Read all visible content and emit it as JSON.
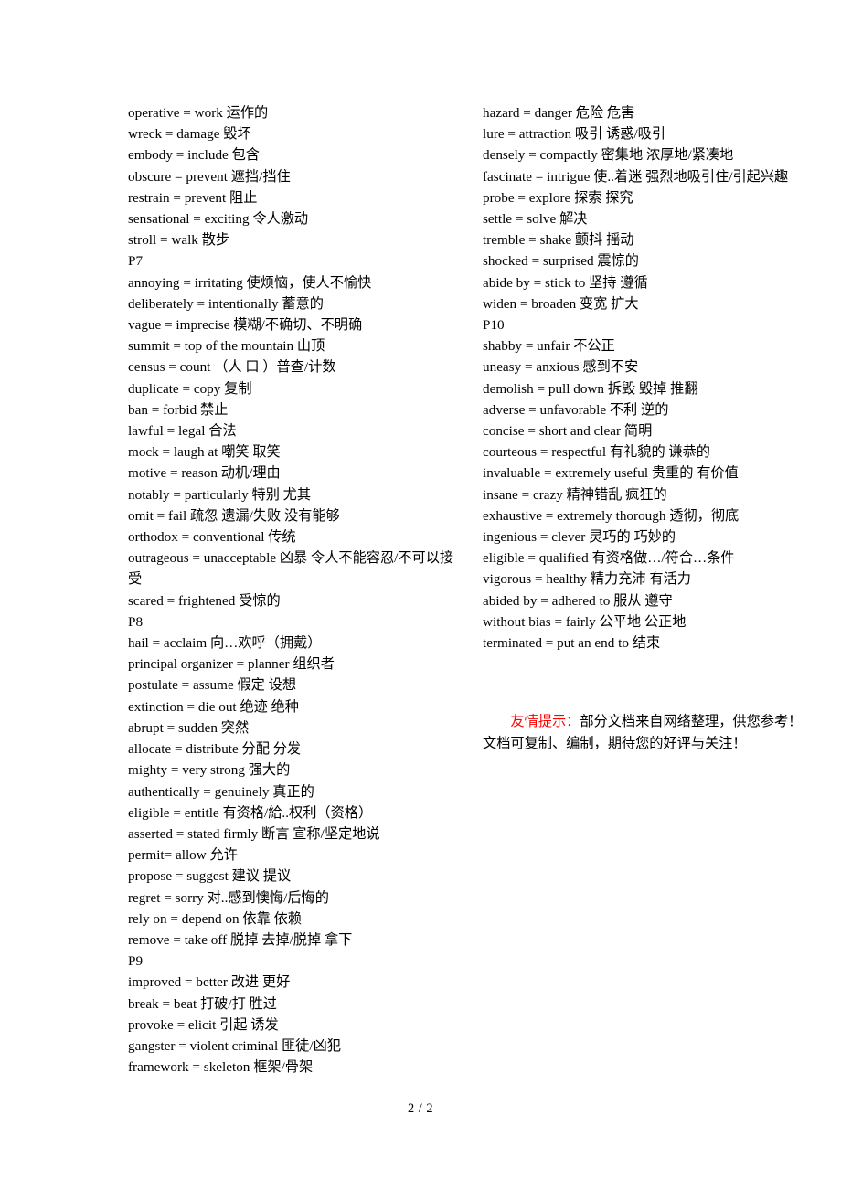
{
  "document": {
    "page_label": "2 / 2"
  },
  "left_column": [
    {
      "text": "operative = work 运作的",
      "type": "entry"
    },
    {
      "text": "wreck = damage 毁坏",
      "type": "entry"
    },
    {
      "text": "embody = include 包含",
      "type": "entry"
    },
    {
      "text": "obscure = prevent 遮挡/挡住",
      "type": "entry"
    },
    {
      "text": "restrain = prevent 阻止",
      "type": "entry"
    },
    {
      "text": "sensational = exciting 令人激动",
      "type": "entry"
    },
    {
      "text": "stroll = walk  散步",
      "type": "entry"
    },
    {
      "text": "P7",
      "type": "section"
    },
    {
      "text": "annoying = irritating 使烦恼，使人不愉快",
      "type": "entry"
    },
    {
      "text": "deliberately = intentionally  蓄意的",
      "type": "entry"
    },
    {
      "text": "vague = imprecise 模糊/不确切、不明确",
      "type": "entry"
    },
    {
      "text": "summit = top of the mountain  山顶",
      "type": "entry"
    },
    {
      "text": "census = count  （人 口 ）普查/计数",
      "type": "entry"
    },
    {
      "text": "duplicate  =  copy 复制",
      "type": "entry"
    },
    {
      "text": "ban = forbid  禁止",
      "type": "entry"
    },
    {
      "text": "lawful = legal  合法",
      "type": "entry"
    },
    {
      "text": "mock = laugh at  嘲笑  取笑",
      "type": "entry"
    },
    {
      "text": "motive = reason  动机/理由",
      "type": "entry"
    },
    {
      "text": "notably = particularly  特别  尤其",
      "type": "entry"
    },
    {
      "text": "omit = fail  疏忽  遗漏/失败  没有能够",
      "type": "entry"
    },
    {
      "text": "orthodox = conventional  传统",
      "type": "entry"
    },
    {
      "text": "outrageous = unacceptable  凶暴  令人不能容忍/不可以接受",
      "type": "entry"
    },
    {
      "text": "scared = frightened  受惊的",
      "type": "entry"
    },
    {
      "text": "P8",
      "type": "section"
    },
    {
      "text": "hail = acclaim  向…欢呼（拥戴）",
      "type": "entry"
    },
    {
      "text": "principal organizer = planner  组织者",
      "type": "entry"
    },
    {
      "text": "postulate = assume  假定  设想",
      "type": "entry"
    },
    {
      "text": "extinction = die out  绝迹  绝种",
      "type": "entry"
    },
    {
      "text": "abrupt = sudden  突然",
      "type": "entry"
    },
    {
      "text": "allocate = distribute  分配  分发",
      "type": "entry"
    },
    {
      "text": "mighty = very strong  强大的",
      "type": "entry"
    },
    {
      "text": "authentically = genuinely  真正的",
      "type": "entry"
    },
    {
      "text": "eligible = entitle 有资格/給..权利（资格）",
      "type": "entry"
    },
    {
      "text": "asserted = stated firmly  断言  宣称/坚定地说",
      "type": "entry"
    },
    {
      "text": "permit= allow  允许",
      "type": "entry"
    },
    {
      "text": "propose = suggest  建议  提议",
      "type": "entry"
    },
    {
      "text": "regret = sorry  对..感到懊悔/后悔的",
      "type": "entry"
    },
    {
      "text": "rely on = depend on  依靠  依赖",
      "type": "entry"
    },
    {
      "text": "remove = take off  脱掉  去掉/脱掉  拿下",
      "type": "entry"
    },
    {
      "text": "P9",
      "type": "section"
    },
    {
      "text": "improved = better  改进  更好",
      "type": "entry"
    },
    {
      "text": "break = beat  打破/打  胜过",
      "type": "entry"
    },
    {
      "text": "provoke = elicit  引起  诱发",
      "type": "entry"
    },
    {
      "text": "gangster = violent criminal  匪徒/凶犯",
      "type": "entry"
    },
    {
      "text": "framework = skeleton  框架/骨架",
      "type": "entry"
    }
  ],
  "right_column": [
    {
      "text": "hazard = danger  危险  危害",
      "type": "entry"
    },
    {
      "text": "lure = attraction  吸引  诱惑/吸引",
      "type": "entry"
    },
    {
      "text": "densely = compactly  密集地  浓厚地/紧凑地",
      "type": "entry"
    },
    {
      "text": "fascinate = intrigue  使..着迷  强烈地吸引住/引起兴趣",
      "type": "entry"
    },
    {
      "text": "probe = explore  探索  探究",
      "type": "entry"
    },
    {
      "text": "settle = solve  解决",
      "type": "entry"
    },
    {
      "text": "tremble = shake  颤抖  摇动",
      "type": "entry"
    },
    {
      "text": "shocked = surprised  震惊的",
      "type": "entry"
    },
    {
      "text": "abide by = stick to  坚持  遵循",
      "type": "entry"
    },
    {
      "text": "widen = broaden  变宽  扩大",
      "type": "entry"
    },
    {
      "text": "P10",
      "type": "section"
    },
    {
      "text": "shabby = unfair  不公正",
      "type": "entry"
    },
    {
      "text": "uneasy = anxious  感到不安",
      "type": "entry"
    },
    {
      "text": "demolish = pull down 拆毁  毁掉  推翻",
      "type": "entry"
    },
    {
      "text": "adverse = unfavorable  不利  逆的",
      "type": "entry"
    },
    {
      "text": "concise = short and clear  简明",
      "type": "entry"
    },
    {
      "text": "courteous = respectful  有礼貌的  谦恭的",
      "type": "entry"
    },
    {
      "text": "invaluable = extremely useful 贵重的  有价值",
      "type": "entry"
    },
    {
      "text": "insane = crazy  精神错乱  疯狂的",
      "type": "entry"
    },
    {
      "text": "exhaustive = extremely thorough  透彻，彻底",
      "type": "entry"
    },
    {
      "text": "ingenious = clever 灵巧的  巧妙的",
      "type": "entry"
    },
    {
      "text": "eligible = qualified 有资格做…/符合…条件",
      "type": "entry"
    },
    {
      "text": "vigorous = healthy  精力充沛  有活力",
      "type": "entry"
    },
    {
      "text": "abided by = adhered to  服从  遵守",
      "type": "entry"
    },
    {
      "text": "without bias  =  fairly  公平地  公正地",
      "type": "entry"
    },
    {
      "text": "terminated = put an end to  结束",
      "type": "entry"
    }
  ],
  "notice": {
    "highlight": "友情提示：",
    "body": "部分文档来自网络整理，供您参考！文档可复制、编制，期待您的好评与关注！",
    "highlight_color": "#ff0000"
  }
}
